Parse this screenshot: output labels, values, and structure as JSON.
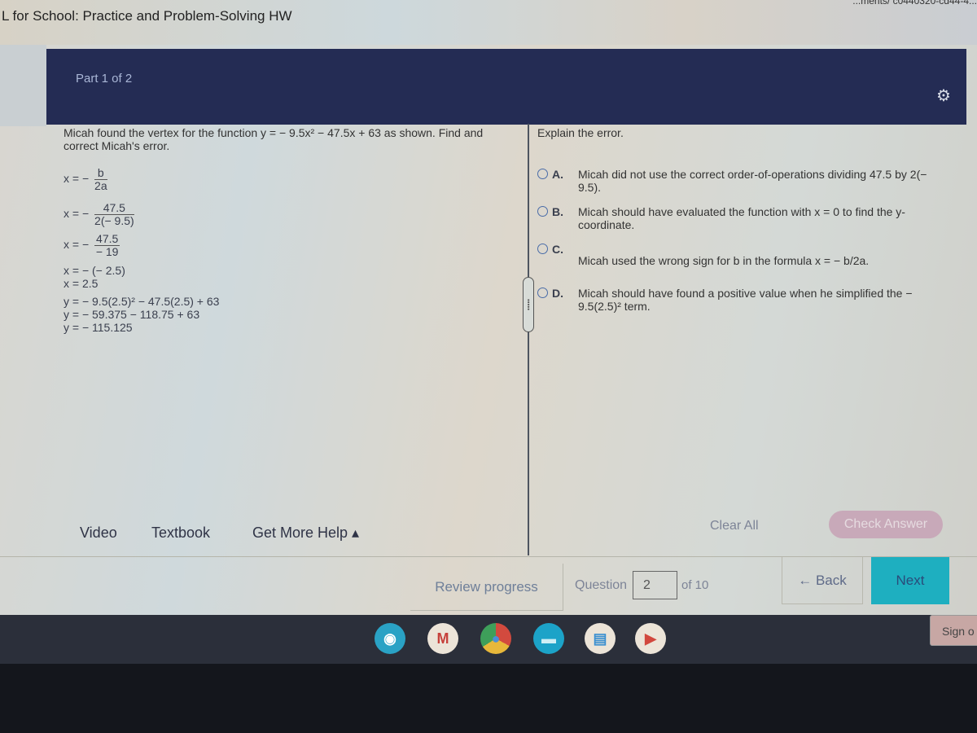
{
  "window": {
    "title": "L for School: Practice and Problem-Solving HW",
    "url_fragment": "...ments/ c0440320-cd44-4..."
  },
  "header": {
    "part_label": "Part 1 of 2",
    "settings_icon": "gear-icon"
  },
  "question": {
    "prompt": "Micah found the vertex for the function y = − 9.5x² − 47.5x + 63 as shown. Find and correct Micah's error.",
    "work": {
      "step1": {
        "lhs": "x = −",
        "num": "b",
        "den": "2a"
      },
      "step2": {
        "lhs": "x = −",
        "num": "47.5",
        "den": "2(− 9.5)"
      },
      "step3": {
        "lhs": "x = −",
        "num": "47.5",
        "den": "− 19"
      },
      "lines": [
        "x = − (− 2.5)",
        "x = 2.5",
        "y = − 9.5(2.5)² − 47.5(2.5) + 63",
        "y = − 59.375 − 118.75 + 63",
        "y = − 115.125"
      ]
    }
  },
  "answer": {
    "instruction": "Explain the error.",
    "options": [
      {
        "letter": "A.",
        "text": "Micah did not use the correct order-of-operations dividing 47.5 by 2(− 9.5).",
        "selected": false
      },
      {
        "letter": "B.",
        "text": "Micah should have evaluated the function with x = 0 to find the y-coordinate.",
        "selected": false
      },
      {
        "letter": "C.",
        "text": "Micah used the wrong sign for b in the formula x = − b/2a.",
        "selected": false
      },
      {
        "letter": "D.",
        "text": "Micah should have found a positive value when he simplified the − 9.5(2.5)² term.",
        "selected": false
      }
    ]
  },
  "tools": {
    "video": "Video",
    "textbook": "Textbook",
    "more_help": "Get More Help ▴"
  },
  "actions": {
    "clear_all": "Clear All",
    "check_answer": "Check Answer"
  },
  "footer": {
    "review_progress": "Review progress",
    "question_label": "Question",
    "question_number": "2",
    "of_total": "of 10",
    "back": "← Back",
    "next": "Next"
  },
  "shelf": {
    "apps": [
      "accessibility-app",
      "gmail",
      "chrome",
      "files",
      "docs",
      "youtube"
    ],
    "sign_out": "Sign o"
  }
}
